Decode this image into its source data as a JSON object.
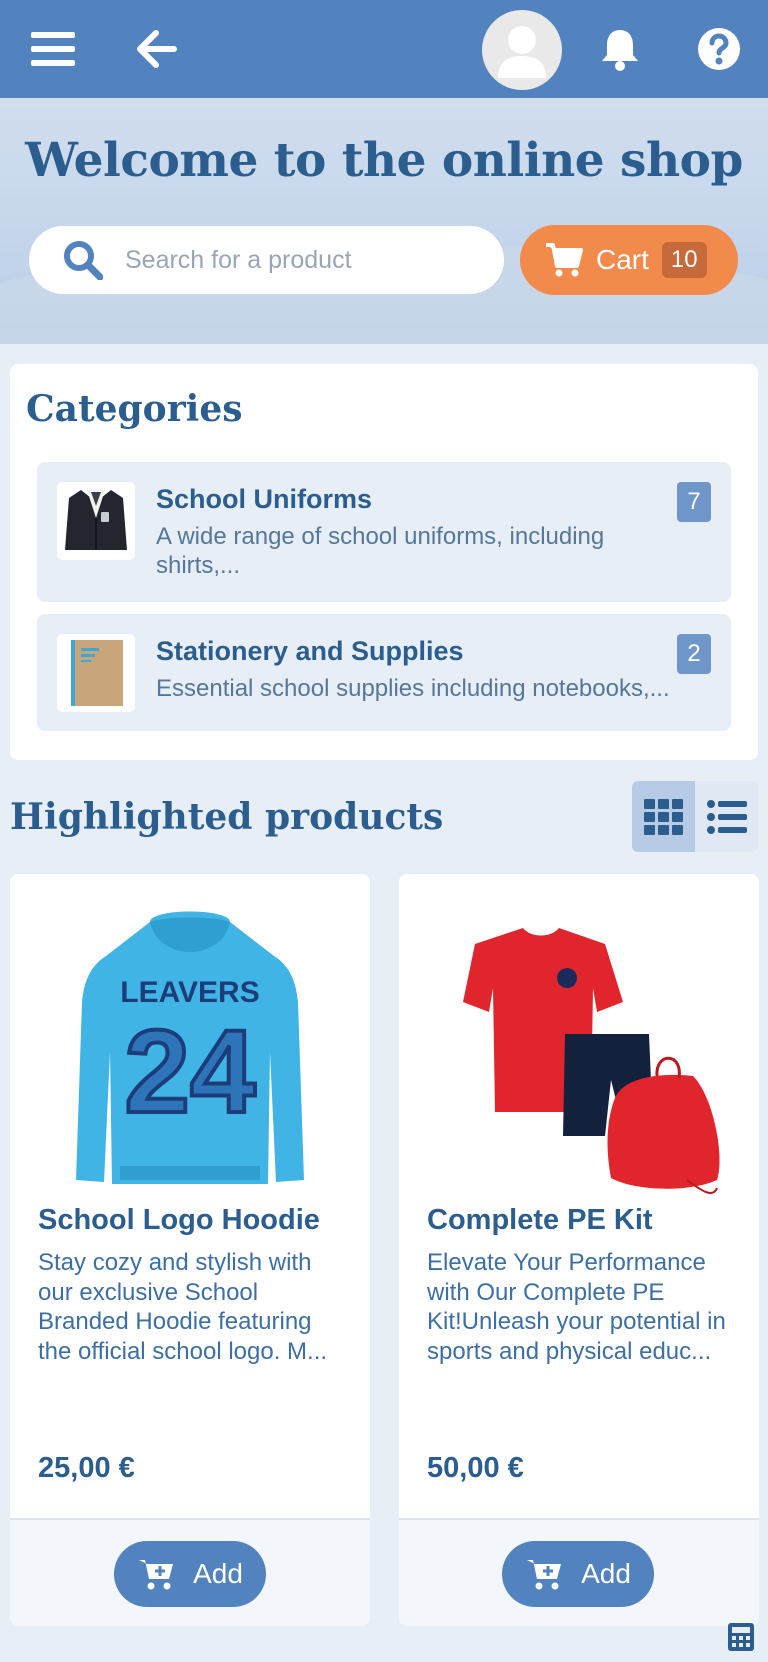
{
  "colors": {
    "primary": "#5383bf",
    "accent": "#f28a4c",
    "heading": "#2b5e8f"
  },
  "topbar": {
    "icons": [
      "menu-icon",
      "back-arrow-icon",
      "user-avatar-icon",
      "bell-icon",
      "help-icon"
    ]
  },
  "hero": {
    "title": "Welcome to the online shop",
    "search_placeholder": "Search for a product",
    "cart_label": "Cart",
    "cart_count": "10"
  },
  "categories": {
    "title": "Categories",
    "items": [
      {
        "title": "School Uniforms",
        "description": "A wide range of school uniforms, including shirts,...",
        "count": "7",
        "thumb_icon": "blazer-icon"
      },
      {
        "title": "Stationery and Supplies",
        "description": "Essential school supplies including notebooks,...",
        "count": "2",
        "thumb_icon": "notebook-icon"
      }
    ]
  },
  "highlighted": {
    "title": "Highlighted products",
    "view_modes": [
      "grid-view-icon",
      "list-view-icon"
    ],
    "active_view": "grid",
    "products": [
      {
        "name": "School Logo Hoodie",
        "description": "Stay cozy and stylish with our exclusive School Branded Hoodie featuring the official school logo. M...",
        "price": "25,00 €",
        "add_label": "Add",
        "image_icon": "hoodie-image",
        "image_text_top": "LEAVERS",
        "image_text_big": "24"
      },
      {
        "name": "Complete PE Kit",
        "description": "Elevate Your Performance with Our Complete PE Kit!Unleash your potential in sports and physical educ...",
        "price": "50,00 €",
        "add_label": "Add",
        "image_icon": "pe-kit-image"
      }
    ]
  },
  "footer": {
    "icon": "calculator-icon"
  }
}
